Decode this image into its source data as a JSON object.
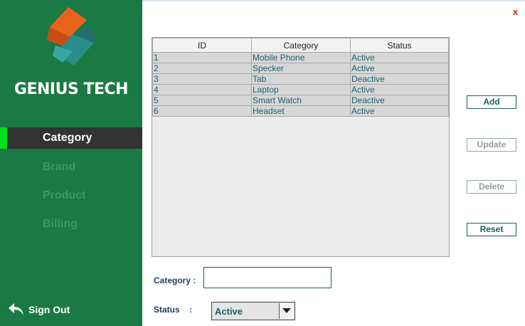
{
  "app": {
    "brand": "GENIUS TECH",
    "close_label": "x"
  },
  "sidebar": {
    "items": [
      {
        "label": "Category",
        "active": true
      },
      {
        "label": "Brand",
        "active": false
      },
      {
        "label": "Product",
        "active": false
      },
      {
        "label": "Billing",
        "active": false
      }
    ],
    "signout_label": "Sign Out"
  },
  "table": {
    "headers": [
      "ID",
      "Category",
      "Status"
    ],
    "rows": [
      [
        "1",
        "Mobile Phone",
        "Active"
      ],
      [
        "2",
        "Specker",
        "Active"
      ],
      [
        "3",
        "Tab",
        "Deactive"
      ],
      [
        "4",
        "Laptop",
        "Active"
      ],
      [
        "5",
        "Smart Watch",
        "Deactive"
      ],
      [
        "6",
        "Headset",
        "Active"
      ]
    ]
  },
  "actions": {
    "add": "Add",
    "update": "Update",
    "delete": "Delete",
    "reset": "Reset"
  },
  "form": {
    "category_label": "Category :",
    "category_value": "",
    "status_label": "Status    :",
    "status_value": "Active"
  },
  "colors": {
    "sidebar_bg": "#1b7a43",
    "active_nav_bg": "#333333",
    "active_marker": "#00e01e",
    "close": "#d62a1f"
  },
  "icons": {
    "logo": "genius-tech-logo",
    "signout": "back-arrow-icon",
    "dropdown": "chevron-down-icon"
  }
}
